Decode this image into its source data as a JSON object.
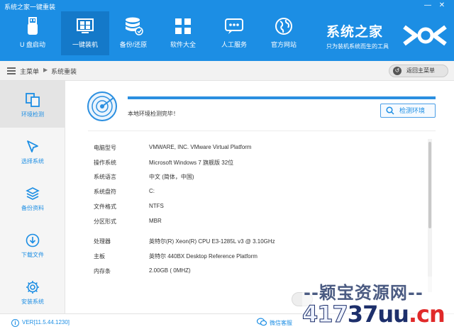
{
  "window": {
    "title": "系统之家一键重装",
    "minimize_glyph": "—",
    "close_glyph": "✕"
  },
  "nav": {
    "items": [
      {
        "label": "U 盘启动",
        "icon": "usb-drive-icon",
        "active": false
      },
      {
        "label": "一键装机",
        "icon": "windows-logo-icon",
        "active": true
      },
      {
        "label": "备份/还原",
        "icon": "database-backup-icon",
        "active": false
      },
      {
        "label": "软件大全",
        "icon": "apps-grid-icon",
        "active": false
      },
      {
        "label": "人工服务",
        "icon": "chat-bubble-icon",
        "active": false
      },
      {
        "label": "官方网站",
        "icon": "globe-icon",
        "active": false
      }
    ]
  },
  "brand": {
    "name": "系统之家",
    "slogan": "只为装机系统而生的工具"
  },
  "breadcrumb": {
    "home": "主菜单",
    "current": "系统重装",
    "separator": "▶",
    "back_button": "返回主菜单"
  },
  "sidebar": {
    "items": [
      {
        "label": "环境检测",
        "icon": "environment-check-icon",
        "active": true
      },
      {
        "label": "选择系统",
        "icon": "cursor-icon",
        "active": false
      },
      {
        "label": "备份资料",
        "icon": "layers-icon",
        "active": false
      },
      {
        "label": "下载文件",
        "icon": "download-icon",
        "active": false
      },
      {
        "label": "安装系统",
        "icon": "gear-icon",
        "active": false
      }
    ]
  },
  "main": {
    "progress": 1.0,
    "status": "本地环境检测完毕！",
    "detect_button": "检测环境",
    "info": [
      {
        "key": "电脑型号",
        "value": "VMWARE, INC. VMware Virtual Platform"
      },
      {
        "key": "操作系统",
        "value": "Microsoft Windows 7 旗舰版  32位"
      },
      {
        "key": "系统语言",
        "value": "中文 (简体，中国)"
      },
      {
        "key": "系统盘符",
        "value": "C:"
      },
      {
        "key": "文件格式",
        "value": "NTFS"
      },
      {
        "key": "分区形式",
        "value": "MBR"
      },
      {
        "key": "处理器",
        "value": "英特尔(R) Xeon(R) CPU E3-1285L v3 @ 3.10GHz"
      },
      {
        "key": "主板",
        "value": "英特尔 440BX Desktop Reference Platform"
      },
      {
        "key": "内存条",
        "value": "2.00GB ( 0MHZ)"
      }
    ]
  },
  "footer": {
    "version": "VER[11.5.44.1230]",
    "wechat": "微信客服"
  },
  "watermark": {
    "line1": "--颖宝资源网--",
    "line2_a": "417",
    "line2_b": "37uu",
    "line2_c": ".cn"
  },
  "colors": {
    "header": "#1c8ee4",
    "active_nav": "#1479c9",
    "accent": "#1c8ee4"
  }
}
